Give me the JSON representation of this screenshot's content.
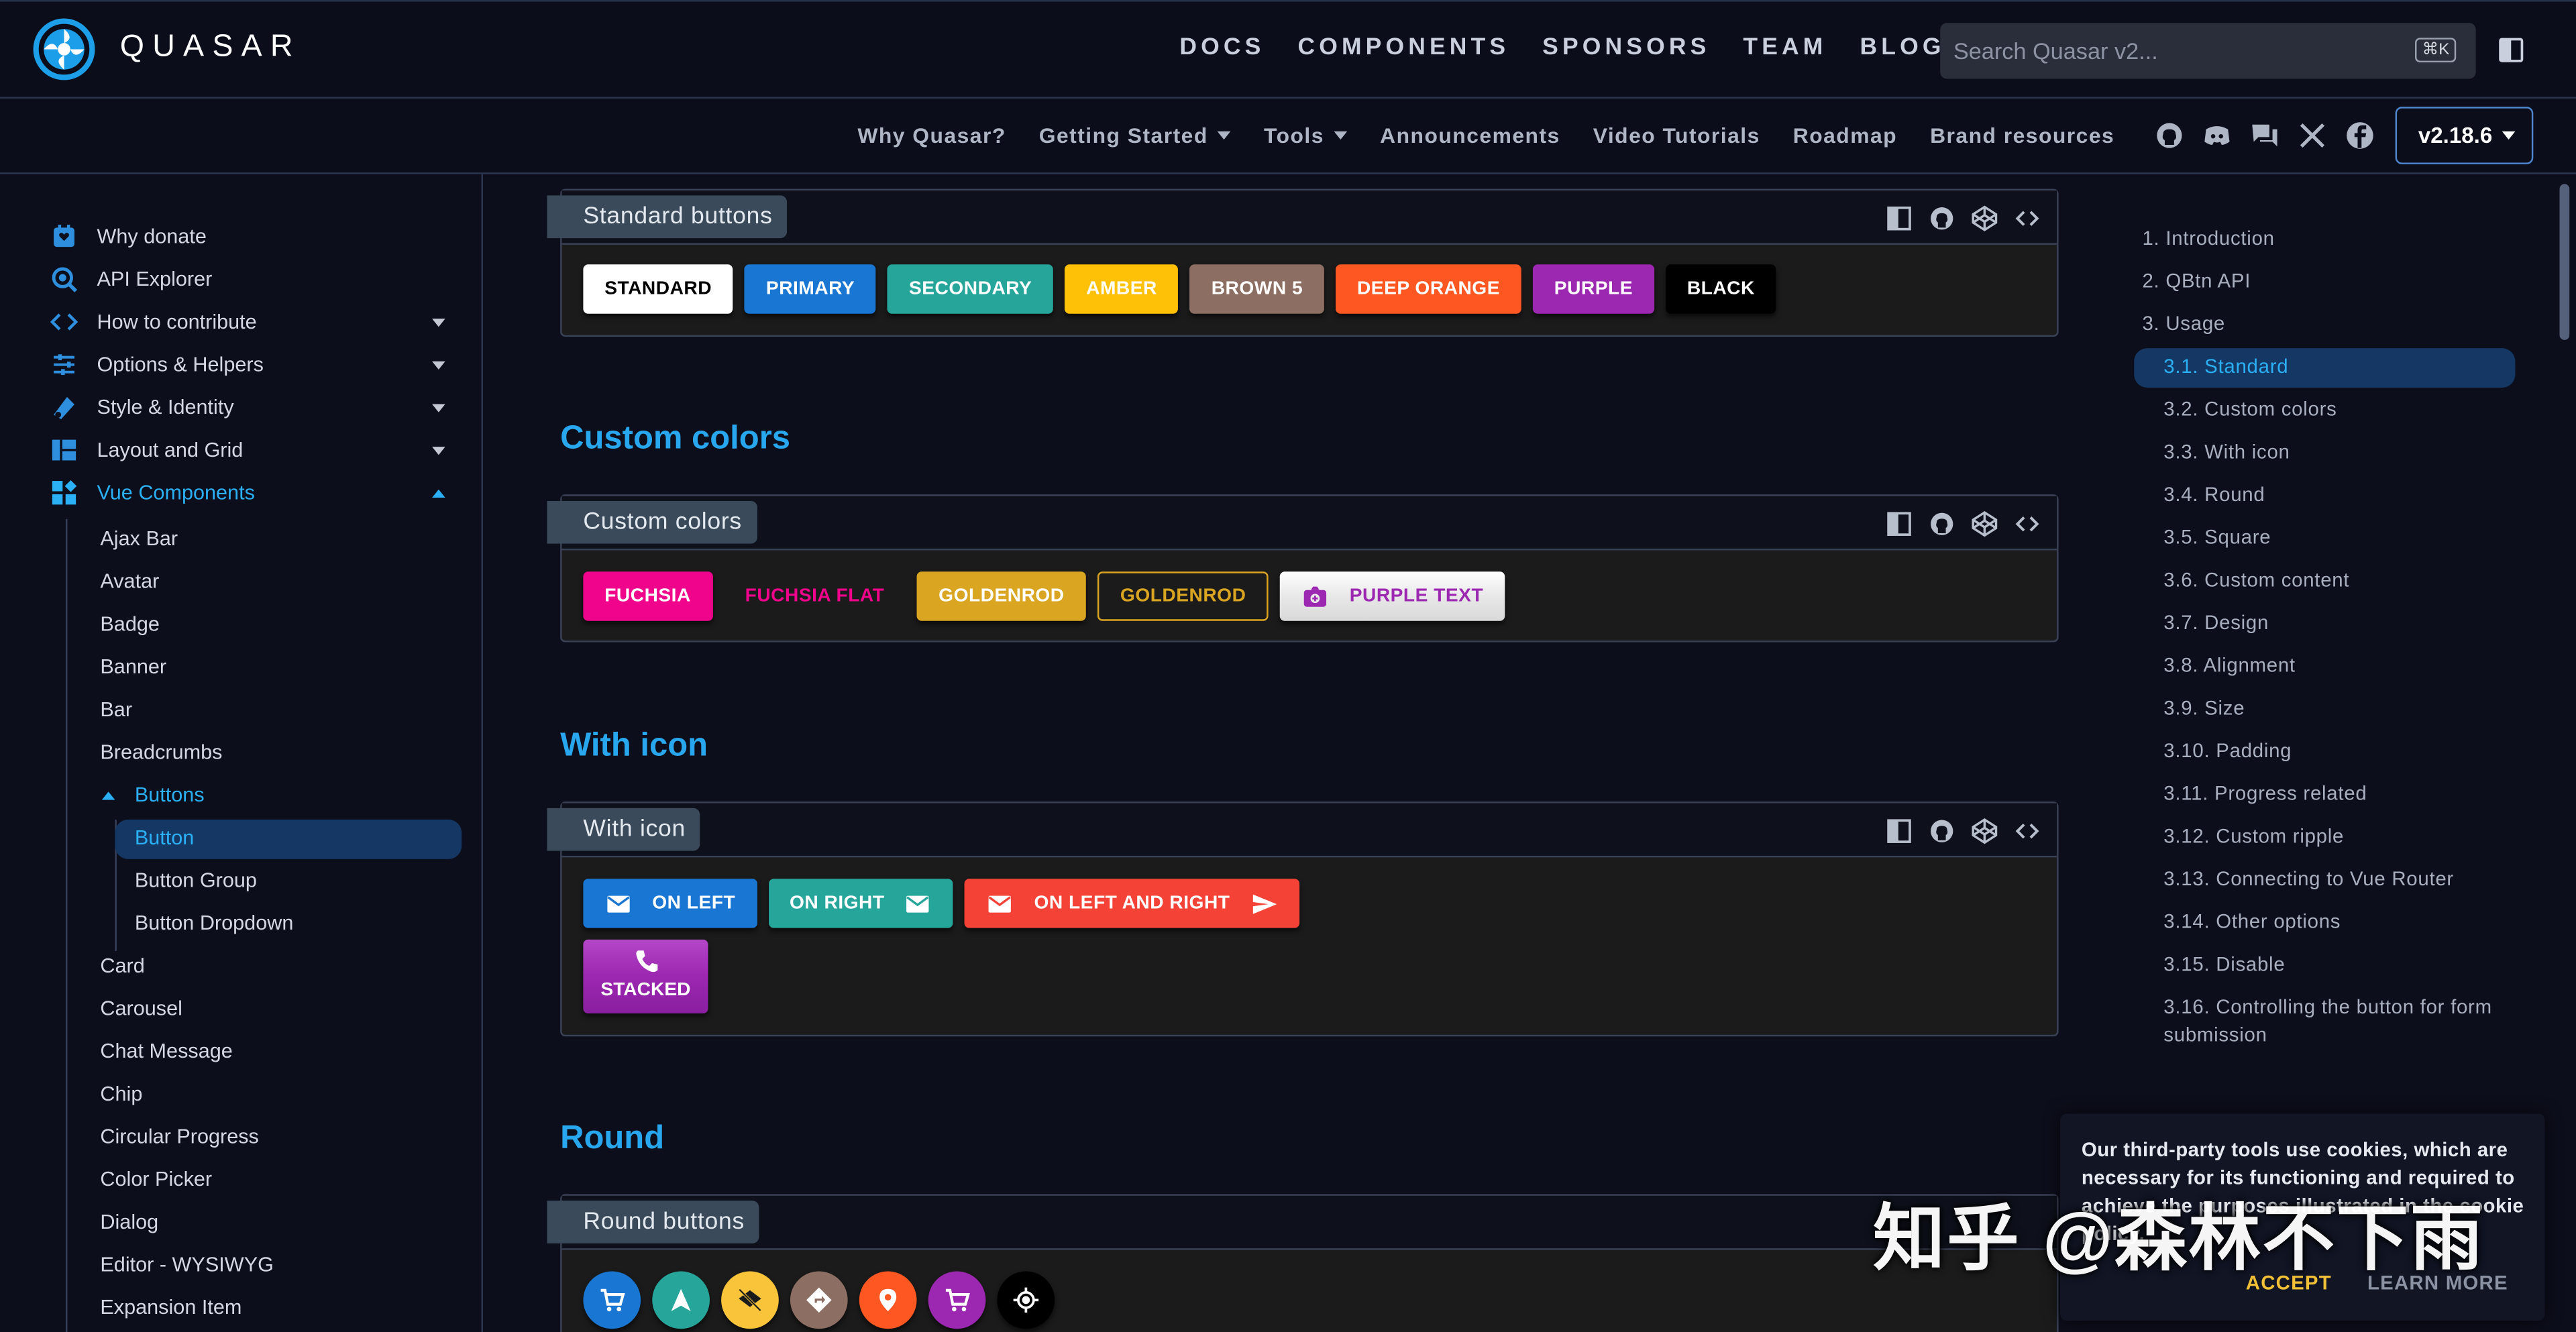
{
  "header": {
    "brand": "QUASAR",
    "nav": [
      "DOCS",
      "COMPONENTS",
      "SPONSORS",
      "TEAM",
      "BLOG"
    ],
    "search_placeholder": "Search Quasar v2...",
    "search_kbd": "⌘K"
  },
  "subnav": {
    "items": [
      {
        "label": "Why Quasar?",
        "has_menu": false
      },
      {
        "label": "Getting Started",
        "has_menu": true
      },
      {
        "label": "Tools",
        "has_menu": true
      },
      {
        "label": "Announcements",
        "has_menu": false
      },
      {
        "label": "Video Tutorials",
        "has_menu": false
      },
      {
        "label": "Roadmap",
        "has_menu": false
      },
      {
        "label": "Brand resources",
        "has_menu": false
      }
    ],
    "social_icons": [
      "github-icon",
      "discord-icon",
      "forum-icon",
      "x-icon",
      "facebook-icon"
    ],
    "version": "v2.18.6"
  },
  "sidebar": {
    "top_items": [
      {
        "label": "Why donate",
        "icon": "donate-icon",
        "expandable": false
      },
      {
        "label": "API Explorer",
        "icon": "api-search-icon",
        "expandable": false
      },
      {
        "label": "How to contribute",
        "icon": "code-icon",
        "expandable": true
      },
      {
        "label": "Options & Helpers",
        "icon": "sliders-icon",
        "expandable": true
      },
      {
        "label": "Style & Identity",
        "icon": "palette-icon",
        "expandable": true
      },
      {
        "label": "Layout and Grid",
        "icon": "layout-icon",
        "expandable": true
      },
      {
        "label": "Vue Components",
        "icon": "widgets-icon",
        "expandable": true,
        "active": true
      }
    ],
    "components": [
      "Ajax Bar",
      "Avatar",
      "Badge",
      "Banner",
      "Bar",
      "Breadcrumbs"
    ],
    "buttons_group": "Buttons",
    "buttons_children": [
      "Button",
      "Button Group",
      "Button Dropdown"
    ],
    "components_after": [
      "Card",
      "Carousel",
      "Chat Message",
      "Chip",
      "Circular Progress",
      "Color Picker",
      "Dialog",
      "Editor - WYSIWYG",
      "Expansion Item"
    ],
    "active_child": "Button"
  },
  "content": {
    "card_standard": {
      "title": "Standard buttons",
      "buttons": [
        {
          "label": "STANDARD",
          "bg": "#ffffff",
          "fg": "#000000"
        },
        {
          "label": "PRIMARY",
          "bg": "#1976d2",
          "fg": "#ffffff"
        },
        {
          "label": "SECONDARY",
          "bg": "#26a69a",
          "fg": "#ffffff"
        },
        {
          "label": "AMBER",
          "bg": "#ffc107",
          "fg": "#ffffff"
        },
        {
          "label": "BROWN 5",
          "bg": "#8d6e63",
          "fg": "#ffffff"
        },
        {
          "label": "DEEP ORANGE",
          "bg": "#ff5722",
          "fg": "#ffffff"
        },
        {
          "label": "PURPLE",
          "bg": "#9c27b0",
          "fg": "#ffffff"
        },
        {
          "label": "BLACK",
          "bg": "#000000",
          "fg": "#ffffff"
        }
      ]
    },
    "section_custom": "Custom colors",
    "card_custom": {
      "title": "Custom colors",
      "buttons": [
        {
          "label": "FUCHSIA",
          "style": "filled",
          "color": "#f0048c"
        },
        {
          "label": "FUCHSIA FLAT",
          "style": "flat",
          "color": "#f0048c"
        },
        {
          "label": "GOLDENROD",
          "style": "filled",
          "color": "#daa520"
        },
        {
          "label": "GOLDENROD",
          "style": "outline",
          "color": "#daa520"
        },
        {
          "label": "PURPLE TEXT",
          "style": "glossy-white",
          "color": "#9c27b0",
          "icon": "camera-icon"
        }
      ]
    },
    "section_icon": "With icon",
    "card_icon": {
      "title": "With icon",
      "buttons": [
        {
          "label": "ON LEFT",
          "bg": "#1976d2"
        },
        {
          "label": "ON RIGHT",
          "bg": "#26a69a"
        },
        {
          "label": "ON LEFT AND RIGHT",
          "bg": "#f44336"
        },
        {
          "label": "STACKED",
          "bg": "#9c27b0"
        }
      ]
    },
    "section_round": "Round",
    "card_round": {
      "title": "Round buttons",
      "colors": [
        "#1976d2",
        "#26a69a",
        "#f9c43a",
        "#8d6e63",
        "#ff5722",
        "#9c27b0",
        "#000000"
      ],
      "icons": [
        "cart-icon",
        "navigation-icon",
        "layers-clear-icon",
        "directions-icon",
        "place-icon",
        "cart-icon",
        "gps-icon"
      ]
    }
  },
  "toc": {
    "items": [
      "1. Introduction",
      "2. QBtn API",
      "3. Usage",
      "3.1. Standard",
      "3.2. Custom colors",
      "3.3. With icon",
      "3.4. Round",
      "3.5. Square",
      "3.6. Custom content",
      "3.7. Design",
      "3.8. Alignment",
      "3.9. Size",
      "3.10. Padding",
      "3.11. Progress related",
      "3.12. Custom ripple",
      "3.13. Connecting to Vue Router",
      "3.14. Other options",
      "3.15. Disable",
      "3.16. Controlling the button for form",
      "submission"
    ],
    "active": "3.1. Standard"
  },
  "cookie": {
    "text": "Our third-party tools use cookies, which are necessary for its functioning and required to achieve the purposes illustrated in the cookie policy.",
    "accept": "ACCEPT",
    "learn_more": "LEARN MORE"
  },
  "watermark": "知乎 @森林不下雨"
}
